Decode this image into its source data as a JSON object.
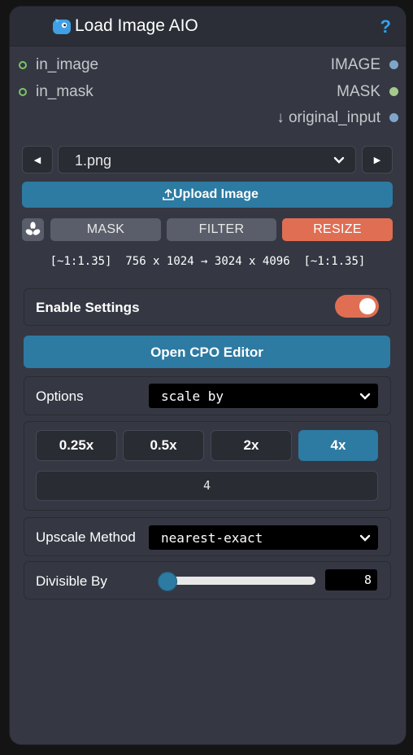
{
  "node": {
    "title": "Load Image AIO",
    "help_label": "?"
  },
  "inputs": [
    {
      "label": "in_image"
    },
    {
      "label": "in_mask"
    }
  ],
  "outputs": [
    {
      "label": "IMAGE"
    },
    {
      "label": "MASK"
    },
    {
      "label": "↓ original_input"
    }
  ],
  "file_select": {
    "value": "1.png"
  },
  "upload": {
    "label": "Upload Image"
  },
  "tabs": [
    {
      "label": "MASK",
      "active": false
    },
    {
      "label": "FILTER",
      "active": false
    },
    {
      "label": "RESIZE",
      "active": true
    }
  ],
  "info_line": "[~1:1.35]  756 x 1024 → 3024 x 4096  [~1:1.35]",
  "enable_settings": {
    "label": "Enable Settings",
    "on": true
  },
  "cpo_editor": {
    "label": "Open CPO Editor"
  },
  "options": {
    "label": "Options",
    "value": "scale by"
  },
  "scale_buttons": [
    {
      "label": "0.25x",
      "active": false
    },
    {
      "label": "0.5x",
      "active": false
    },
    {
      "label": "2x",
      "active": false
    },
    {
      "label": "4x",
      "active": true
    }
  ],
  "scale_value": "4",
  "upscale_method": {
    "label": "Upscale Method",
    "value": "nearest-exact"
  },
  "divisible_by": {
    "label": "Divisible By",
    "value": "8",
    "slider_fraction": 0.0
  },
  "colors": {
    "accent_blue": "#2d7aa2",
    "accent_orange": "#e06e53",
    "help_blue": "#2ea3f2",
    "node_bg": "#353843",
    "header_bg": "#2b2e36"
  }
}
